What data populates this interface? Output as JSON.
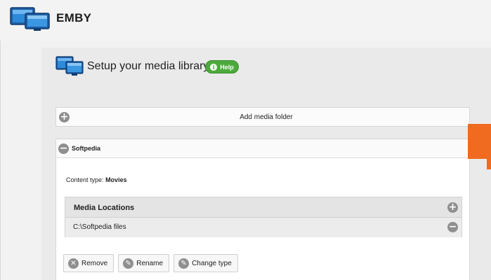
{
  "app": {
    "title": "EMBY",
    "logo_icon": "emby-monitors-icon"
  },
  "setup": {
    "title": "Setup your media library",
    "help_label": "Help",
    "help_icon": "info-icon",
    "help_color": "#4caa3c"
  },
  "add_folder": {
    "label": "Add media folder",
    "icon": "plus-circle-icon"
  },
  "library": {
    "name": "Softpedia",
    "collapse_icon": "minus-circle-icon",
    "content_type_label": "Content type:",
    "content_type_value": "Movies",
    "locations": {
      "title": "Media Locations",
      "add_icon": "plus-circle-icon",
      "rows": [
        {
          "path": "C:\\Softpedia files",
          "remove_icon": "minus-circle-icon"
        }
      ]
    },
    "actions": [
      {
        "label": "Remove",
        "icon": "remove-icon"
      },
      {
        "label": "Rename",
        "icon": "rename-icon"
      },
      {
        "label": "Change type",
        "icon": "edit-icon"
      }
    ]
  },
  "colors": {
    "accent_orange": "#f06a1f",
    "logo_blue": "#1a5fa8"
  }
}
